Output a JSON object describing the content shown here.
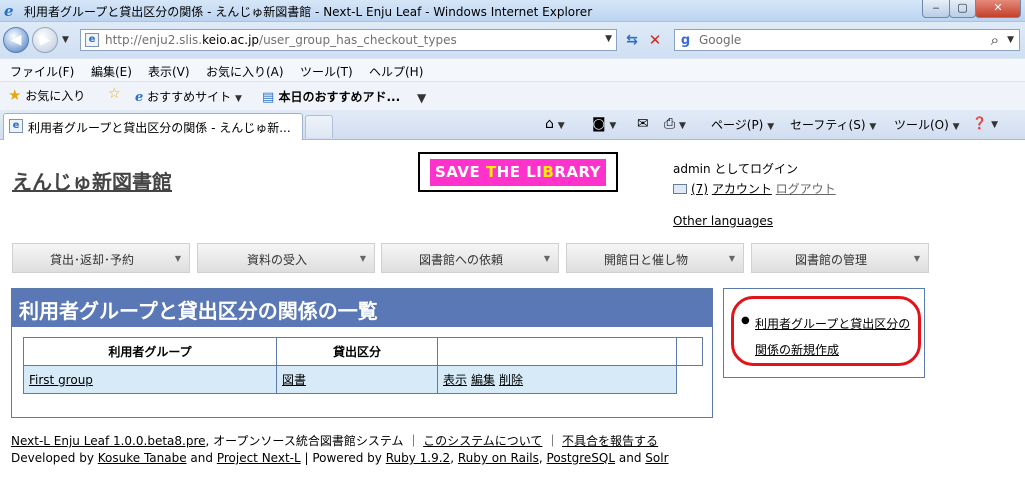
{
  "window": {
    "title": "利用者グループと貸出区分の関係 - えんじゅ新図書館 - Next-L Enju Leaf - Windows Internet Explorer",
    "minimize": "‒",
    "maximize": "▢",
    "close": "✕"
  },
  "navbar": {
    "back": "◀",
    "forward": "▶",
    "url_prefix": "http://enju2.slis.",
    "url_domain": "keio.ac.jp",
    "url_suffix": "/user_group_has_checkout_types",
    "search_placeholder": "Google"
  },
  "menubar": {
    "items": [
      "ファイル(F)",
      "編集(E)",
      "表示(V)",
      "お気に入り(A)",
      "ツール(T)",
      "ヘルプ(H)"
    ]
  },
  "favorites": {
    "favorites_label": "お気に入り",
    "suggested_sites": "おすすめサイト",
    "daily_addons": "本日のおすすめアド..."
  },
  "tabs": {
    "active_tab": "利用者グループと貸出区分の関係 - えんじゅ新..."
  },
  "command_bar": {
    "page": "ページ(P)",
    "safety": "セーフティ(S)",
    "tools": "ツール(O)"
  },
  "header": {
    "site_title": "えんじゅ新図書館",
    "banner_parts": [
      "SAVE ",
      "T",
      "HE LI",
      "B",
      "RARY"
    ],
    "login_status": "admin としてログイン",
    "message_count": "(7)",
    "account": "アカウント",
    "logout": "ログアウト",
    "other_languages": "Other languages"
  },
  "main_menu": {
    "items": [
      "貸出･返却･予約",
      "資料の受入",
      "図書館への依頼",
      "開館日と催し物",
      "図書館の管理"
    ]
  },
  "content": {
    "heading": "利用者グループと貸出区分の関係の一覧",
    "columns": [
      "利用者グループ",
      "貸出区分",
      "",
      ""
    ],
    "rows": [
      {
        "user_group": "First group",
        "checkout_type": "図書",
        "show": "表示",
        "edit": "編集",
        "delete": "削除"
      }
    ]
  },
  "sidebar": {
    "new_link": "利用者グループと貸出区分の関係の新規作成"
  },
  "footer": {
    "line1": {
      "product": "Next-L Enju Leaf 1.0.0.beta8.pre",
      "desc": ", オープンソース統合図書館システム ｜",
      "about": "このシステムについて",
      "sep": " ｜",
      "report": "不具合を報告する"
    },
    "line2": {
      "developed_by": "Developed by ",
      "author": "Kosuke Tanabe",
      "and1": " and ",
      "project": "Project Next-L",
      "powered": " | Powered by ",
      "ruby": "Ruby 1.9.2",
      "comma1": ", ",
      "rails": "Ruby on Rails",
      "comma2": ", ",
      "postgres": "PostgreSQL",
      "and2": " and ",
      "solr": "Solr"
    }
  },
  "colors": {
    "heading_bg": "#5a78b6",
    "row_bg": "#d6ebf7",
    "banner_bg": "#ff33cc",
    "highlight": "#e2141b"
  }
}
